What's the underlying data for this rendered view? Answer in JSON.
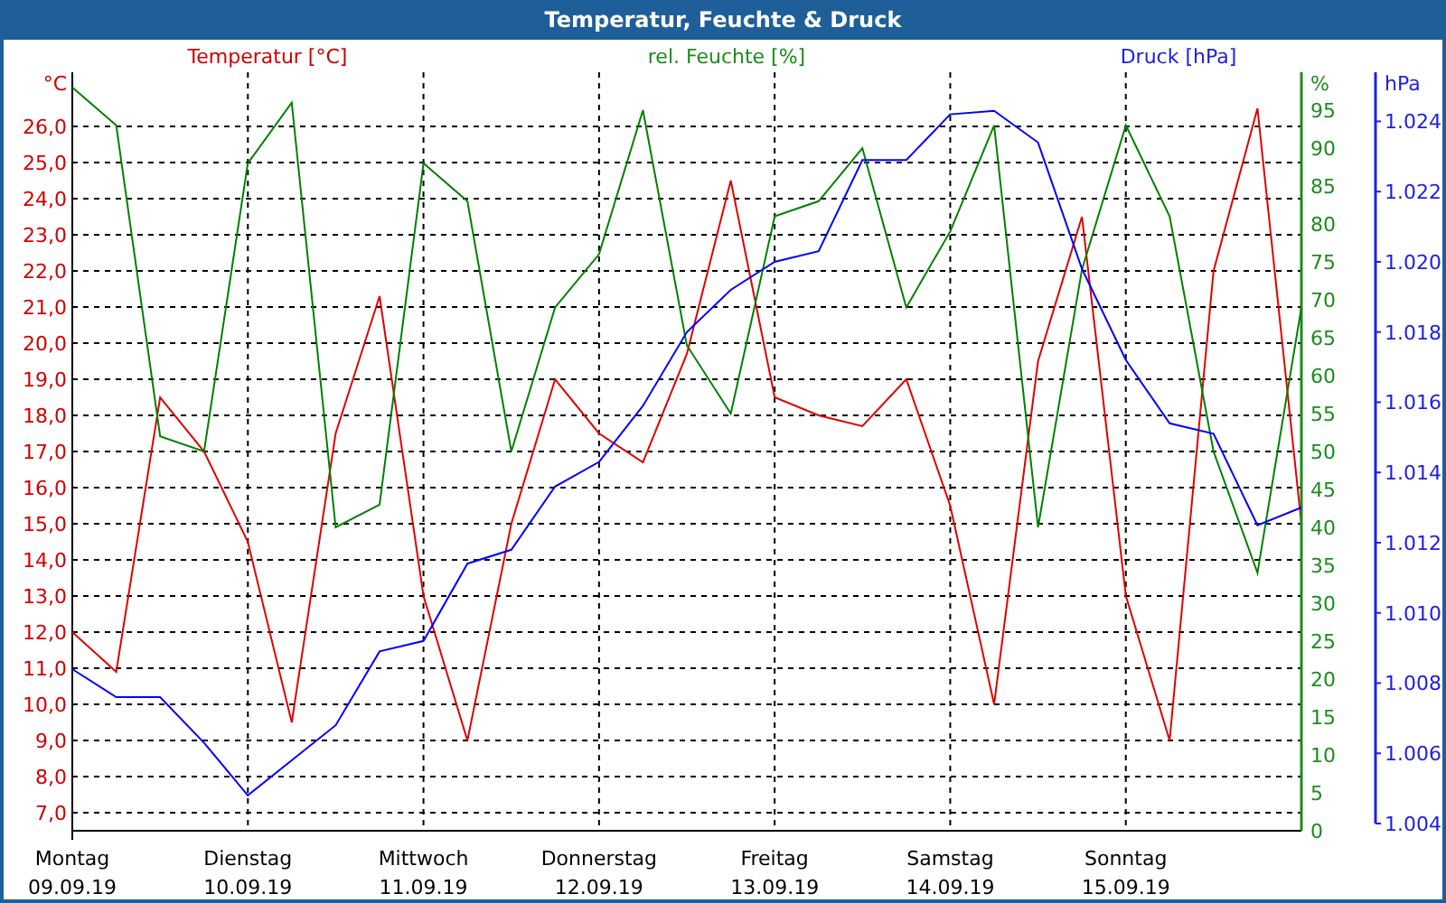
{
  "window": {
    "title": "Temperatur, Feuchte & Druck"
  },
  "charts": [
    {
      "chart_data": {
        "type": "line",
        "grid": true,
        "ylabel": "°C",
        "ylim": [
          6.5,
          27.5
        ],
        "categories": [
          "Montag\n09.09.19",
          null,
          null,
          null,
          "Dienstag\n10.09.19",
          null,
          null,
          null,
          "Mittwoch\n11.09.19",
          null,
          null,
          null,
          "Donnerstag\n12.09.19",
          null,
          null,
          null,
          "Freitag\n13.09.19",
          null,
          null,
          null,
          "Samstag\n14.09.19",
          null,
          null,
          null,
          "Sonntag\n15.09.19",
          null,
          null,
          null,
          null
        ],
        "yticks": [
          {
            "value": 7,
            "label": "7,0"
          },
          {
            "value": 8,
            "label": "8,0"
          },
          {
            "value": 9,
            "label": "9,0"
          },
          {
            "value": 10,
            "label": "10,0"
          },
          {
            "value": 11,
            "label": "11,0"
          },
          {
            "value": 12,
            "label": "12,0"
          },
          {
            "value": 13,
            "label": "13,0"
          },
          {
            "value": 14,
            "label": "14,0"
          },
          {
            "value": 15,
            "label": "15,0"
          },
          {
            "value": 16,
            "label": "16,0"
          },
          {
            "value": 17,
            "label": "17,0"
          },
          {
            "value": 18,
            "label": "18,0"
          },
          {
            "value": 19,
            "label": "19,0"
          },
          {
            "value": 20,
            "label": "20,0"
          },
          {
            "value": 21,
            "label": "21,0"
          },
          {
            "value": 22,
            "label": "22,0"
          },
          {
            "value": 23,
            "label": "23,0"
          },
          {
            "value": 24,
            "label": "24,0"
          },
          {
            "value": 25,
            "label": "25,0"
          },
          {
            "value": 26,
            "label": "26,0"
          }
        ],
        "series": [
          {
            "name": "Temperatur [°C]",
            "color": "#e00000",
            "values": [
              12.0,
              10.9,
              18.5,
              17.0,
              14.5,
              9.5,
              17.5,
              21.3,
              13.0,
              9.0,
              15.0,
              19.0,
              17.5,
              16.7,
              19.7,
              24.5,
              18.5,
              18.0,
              17.7,
              19.0,
              15.5,
              10.0,
              19.5,
              23.5,
              13.0,
              9.0,
              22.0,
              26.5,
              15.0
            ]
          }
        ]
      }
    },
    {
      "chart_data": {
        "type": "line",
        "ylabel": "%",
        "ylim": [
          0,
          100
        ],
        "yticks": [
          {
            "value": 0,
            "label": "0"
          },
          {
            "value": 5,
            "label": "5"
          },
          {
            "value": 10,
            "label": "10"
          },
          {
            "value": 15,
            "label": "15"
          },
          {
            "value": 20,
            "label": "20"
          },
          {
            "value": 25,
            "label": "25"
          },
          {
            "value": 30,
            "label": "30"
          },
          {
            "value": 35,
            "label": "35"
          },
          {
            "value": 40,
            "label": "40"
          },
          {
            "value": 45,
            "label": "45"
          },
          {
            "value": 50,
            "label": "50"
          },
          {
            "value": 55,
            "label": "55"
          },
          {
            "value": 60,
            "label": "60"
          },
          {
            "value": 65,
            "label": "65"
          },
          {
            "value": 70,
            "label": "70"
          },
          {
            "value": 75,
            "label": "75"
          },
          {
            "value": 80,
            "label": "80"
          },
          {
            "value": 85,
            "label": "85"
          },
          {
            "value": 90,
            "label": "90"
          },
          {
            "value": 95,
            "label": "95"
          }
        ],
        "series": [
          {
            "name": "rel. Feuchte [%]",
            "color": "#008000",
            "values": [
              98,
              93,
              52,
              50,
              88,
              96,
              40,
              43,
              88,
              83,
              50,
              69,
              76,
              95,
              64,
              55,
              81,
              83,
              90,
              69,
              79,
              93,
              40,
              74,
              93,
              81,
              50,
              34,
              69
            ]
          }
        ]
      }
    },
    {
      "chart_data": {
        "type": "line",
        "ylabel": "hPa",
        "ylim": [
          1004,
          1025.4
        ],
        "yticks": [
          {
            "value": 1004,
            "label": "1.004"
          },
          {
            "value": 1006,
            "label": "1.006"
          },
          {
            "value": 1008,
            "label": "1.008"
          },
          {
            "value": 1010,
            "label": "1.010"
          },
          {
            "value": 1012,
            "label": "1.012"
          },
          {
            "value": 1014,
            "label": "1.014"
          },
          {
            "value": 1016,
            "label": "1.016"
          },
          {
            "value": 1018,
            "label": "1.018"
          },
          {
            "value": 1020,
            "label": "1.020"
          },
          {
            "value": 1022,
            "label": "1.022"
          },
          {
            "value": 1024,
            "label": "1.024"
          }
        ],
        "series": [
          {
            "name": "Druck [hPa]",
            "color": "#0000ff",
            "values": [
              1008.4,
              1007.6,
              1007.6,
              1006.3,
              1004.8,
              1005.8,
              1006.8,
              1008.9,
              1009.2,
              1011.4,
              1011.8,
              1013.6,
              1014.3,
              1015.9,
              1018.0,
              1019.2,
              1020.0,
              1020.3,
              1022.9,
              1022.9,
              1024.2,
              1024.3,
              1023.4,
              1019.8,
              1017.2,
              1015.4,
              1015.1,
              1012.5,
              1013.0
            ]
          }
        ]
      }
    }
  ]
}
